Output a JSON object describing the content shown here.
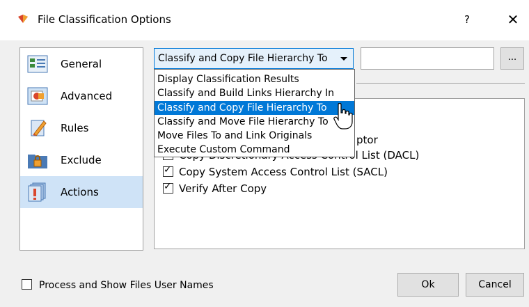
{
  "window": {
    "title": "File Classification Options",
    "help_label": "?",
    "close_label": "✕"
  },
  "sidebar": {
    "items": [
      {
        "label": "General",
        "icon": "general-icon"
      },
      {
        "label": "Advanced",
        "icon": "advanced-icon"
      },
      {
        "label": "Rules",
        "icon": "rules-icon"
      },
      {
        "label": "Exclude",
        "icon": "exclude-icon"
      },
      {
        "label": "Actions",
        "icon": "actions-icon",
        "selected": true
      }
    ]
  },
  "action_combo": {
    "value": "Classify and Copy File Hierarchy To",
    "options": [
      "Display Classification Results",
      "Classify and Build Links Hierarchy In",
      "Classify and Copy File Hierarchy To",
      "Classify and Move File Hierarchy To",
      "Move Files To and Link Originals",
      "Execute Custom Command"
    ],
    "selected_index": 2
  },
  "target_path": {
    "value": ""
  },
  "browse_label": "...",
  "options": {
    "partial_text": "ptor",
    "dacl": {
      "label": "Copy Discretionary Access Control List (DACL)",
      "checked": true
    },
    "sacl": {
      "label": "Copy System Access Control List (SACL)",
      "checked": true
    },
    "verify": {
      "label": "Verify After Copy",
      "checked": true
    }
  },
  "footer": {
    "user_names_label": "Process and Show Files User Names",
    "user_names_checked": false,
    "ok_label": "Ok",
    "cancel_label": "Cancel"
  },
  "colors": {
    "accent": "#0078d7",
    "sidebar_selected": "#cfe3f7",
    "window_bg": "#f0f0f0"
  }
}
